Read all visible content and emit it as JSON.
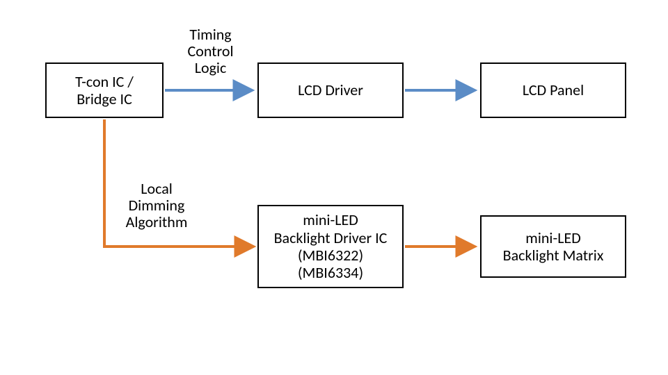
{
  "nodes": {
    "tcon": {
      "line1": "T-con IC /",
      "line2": "Bridge IC"
    },
    "lcddriver": {
      "text": "LCD Driver"
    },
    "lcdpanel": {
      "text": "LCD Panel"
    },
    "bldriver": {
      "line1": "mini-LED",
      "line2": "Backlight Driver IC",
      "line3": "(MBI6322)",
      "line4": "(MBI6334)"
    },
    "blmatrix": {
      "line1": "mini-LED",
      "line2": "Backlight Matrix"
    }
  },
  "edges": {
    "timing": {
      "line1": "Timing",
      "line2": "Control",
      "line3": "Logic"
    },
    "dimming": {
      "line1": "Local",
      "line2": "Dimming",
      "line3": "Algorithm"
    }
  },
  "colors": {
    "blue": "#5b8cc6",
    "orange": "#e07a2b"
  },
  "chart_data": {
    "type": "diagram",
    "title": "",
    "nodes": [
      {
        "id": "tcon",
        "label": "T-con IC / Bridge IC"
      },
      {
        "id": "lcddriver",
        "label": "LCD Driver"
      },
      {
        "id": "lcdpanel",
        "label": "LCD Panel"
      },
      {
        "id": "bldriver",
        "label": "mini-LED Backlight Driver IC (MBI6322) (MBI6334)"
      },
      {
        "id": "blmatrix",
        "label": "mini-LED Backlight Matrix"
      }
    ],
    "edges": [
      {
        "from": "tcon",
        "to": "lcddriver",
        "label": "Timing Control Logic",
        "color": "#5b8cc6"
      },
      {
        "from": "lcddriver",
        "to": "lcdpanel",
        "label": "",
        "color": "#5b8cc6"
      },
      {
        "from": "tcon",
        "to": "bldriver",
        "label": "Local Dimming Algorithm",
        "color": "#e07a2b"
      },
      {
        "from": "bldriver",
        "to": "blmatrix",
        "label": "",
        "color": "#e07a2b"
      }
    ]
  }
}
